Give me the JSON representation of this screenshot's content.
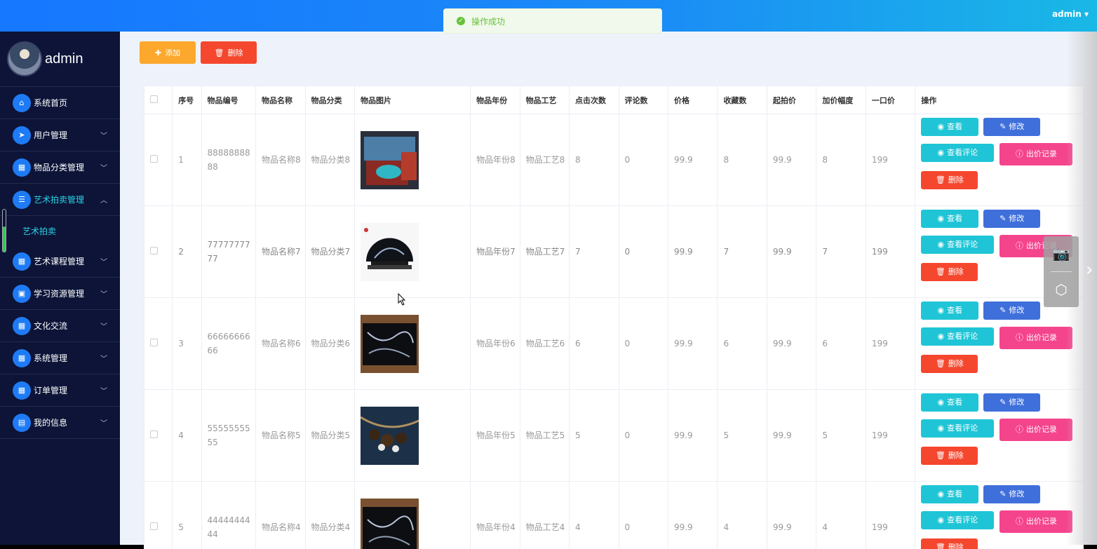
{
  "header": {
    "user": "admin ▾"
  },
  "toast": {
    "message": "操作成功"
  },
  "sidebar": {
    "username": "admin",
    "items": [
      {
        "label": "系统首页",
        "icon": "home-icon"
      },
      {
        "label": "用户管理",
        "icon": "send-icon"
      },
      {
        "label": "物品分类管理",
        "icon": "grid-icon"
      },
      {
        "label": "艺术拍卖管理",
        "icon": "list-icon",
        "expanded": true
      },
      {
        "label": "艺术课程管理",
        "icon": "grid-icon"
      },
      {
        "label": "学习资源管理",
        "icon": "briefcase-icon"
      },
      {
        "label": "文化交流",
        "icon": "grid-icon"
      },
      {
        "label": "系统管理",
        "icon": "grid-icon"
      },
      {
        "label": "订单管理",
        "icon": "grid-icon"
      },
      {
        "label": "我的信息",
        "icon": "card-icon"
      }
    ],
    "submenu": {
      "label": "艺术拍卖"
    }
  },
  "toolbar": {
    "add_label": "添加",
    "delete_label": "删除"
  },
  "table": {
    "headers": [
      "序号",
      "物品编号",
      "物品名称",
      "物品分类",
      "物品图片",
      "物品年份",
      "物品工艺",
      "点击次数",
      "评论数",
      "价格",
      "收藏数",
      "起拍价",
      "加价幅度",
      "一口价",
      "操作"
    ],
    "rows": [
      {
        "index": "1",
        "code": "8888888888",
        "name": "物品名称8",
        "category": "物品分类8",
        "year": "物品年份8",
        "craft": "物品工艺8",
        "clicks": "8",
        "comments": "0",
        "price": "99.9",
        "favorites": "8",
        "start_price": "99.9",
        "increment": "8",
        "buyout": "199"
      },
      {
        "index": "2",
        "code": "7777777777",
        "name": "物品名称7",
        "category": "物品分类7",
        "year": "物品年份7",
        "craft": "物品工艺7",
        "clicks": "7",
        "comments": "0",
        "price": "99.9",
        "favorites": "7",
        "start_price": "99.9",
        "increment": "7",
        "buyout": "199"
      },
      {
        "index": "3",
        "code": "6666666666",
        "name": "物品名称6",
        "category": "物品分类6",
        "year": "物品年份6",
        "craft": "物品工艺6",
        "clicks": "6",
        "comments": "0",
        "price": "99.9",
        "favorites": "6",
        "start_price": "99.9",
        "increment": "6",
        "buyout": "199"
      },
      {
        "index": "4",
        "code": "5555555555",
        "name": "物品名称5",
        "category": "物品分类5",
        "year": "物品年份5",
        "craft": "物品工艺5",
        "clicks": "5",
        "comments": "0",
        "price": "99.9",
        "favorites": "5",
        "start_price": "99.9",
        "increment": "5",
        "buyout": "199"
      },
      {
        "index": "5",
        "code": "4444444444",
        "name": "物品名称4",
        "category": "物品分类4",
        "year": "物品年份4",
        "craft": "物品工艺4",
        "clicks": "4",
        "comments": "0",
        "price": "99.9",
        "favorites": "4",
        "start_price": "99.9",
        "increment": "4",
        "buyout": "199"
      }
    ],
    "actions": {
      "view": "查看",
      "edit": "修改",
      "comments": "查看评论",
      "bids": "出价记录",
      "delete": "删除"
    }
  }
}
